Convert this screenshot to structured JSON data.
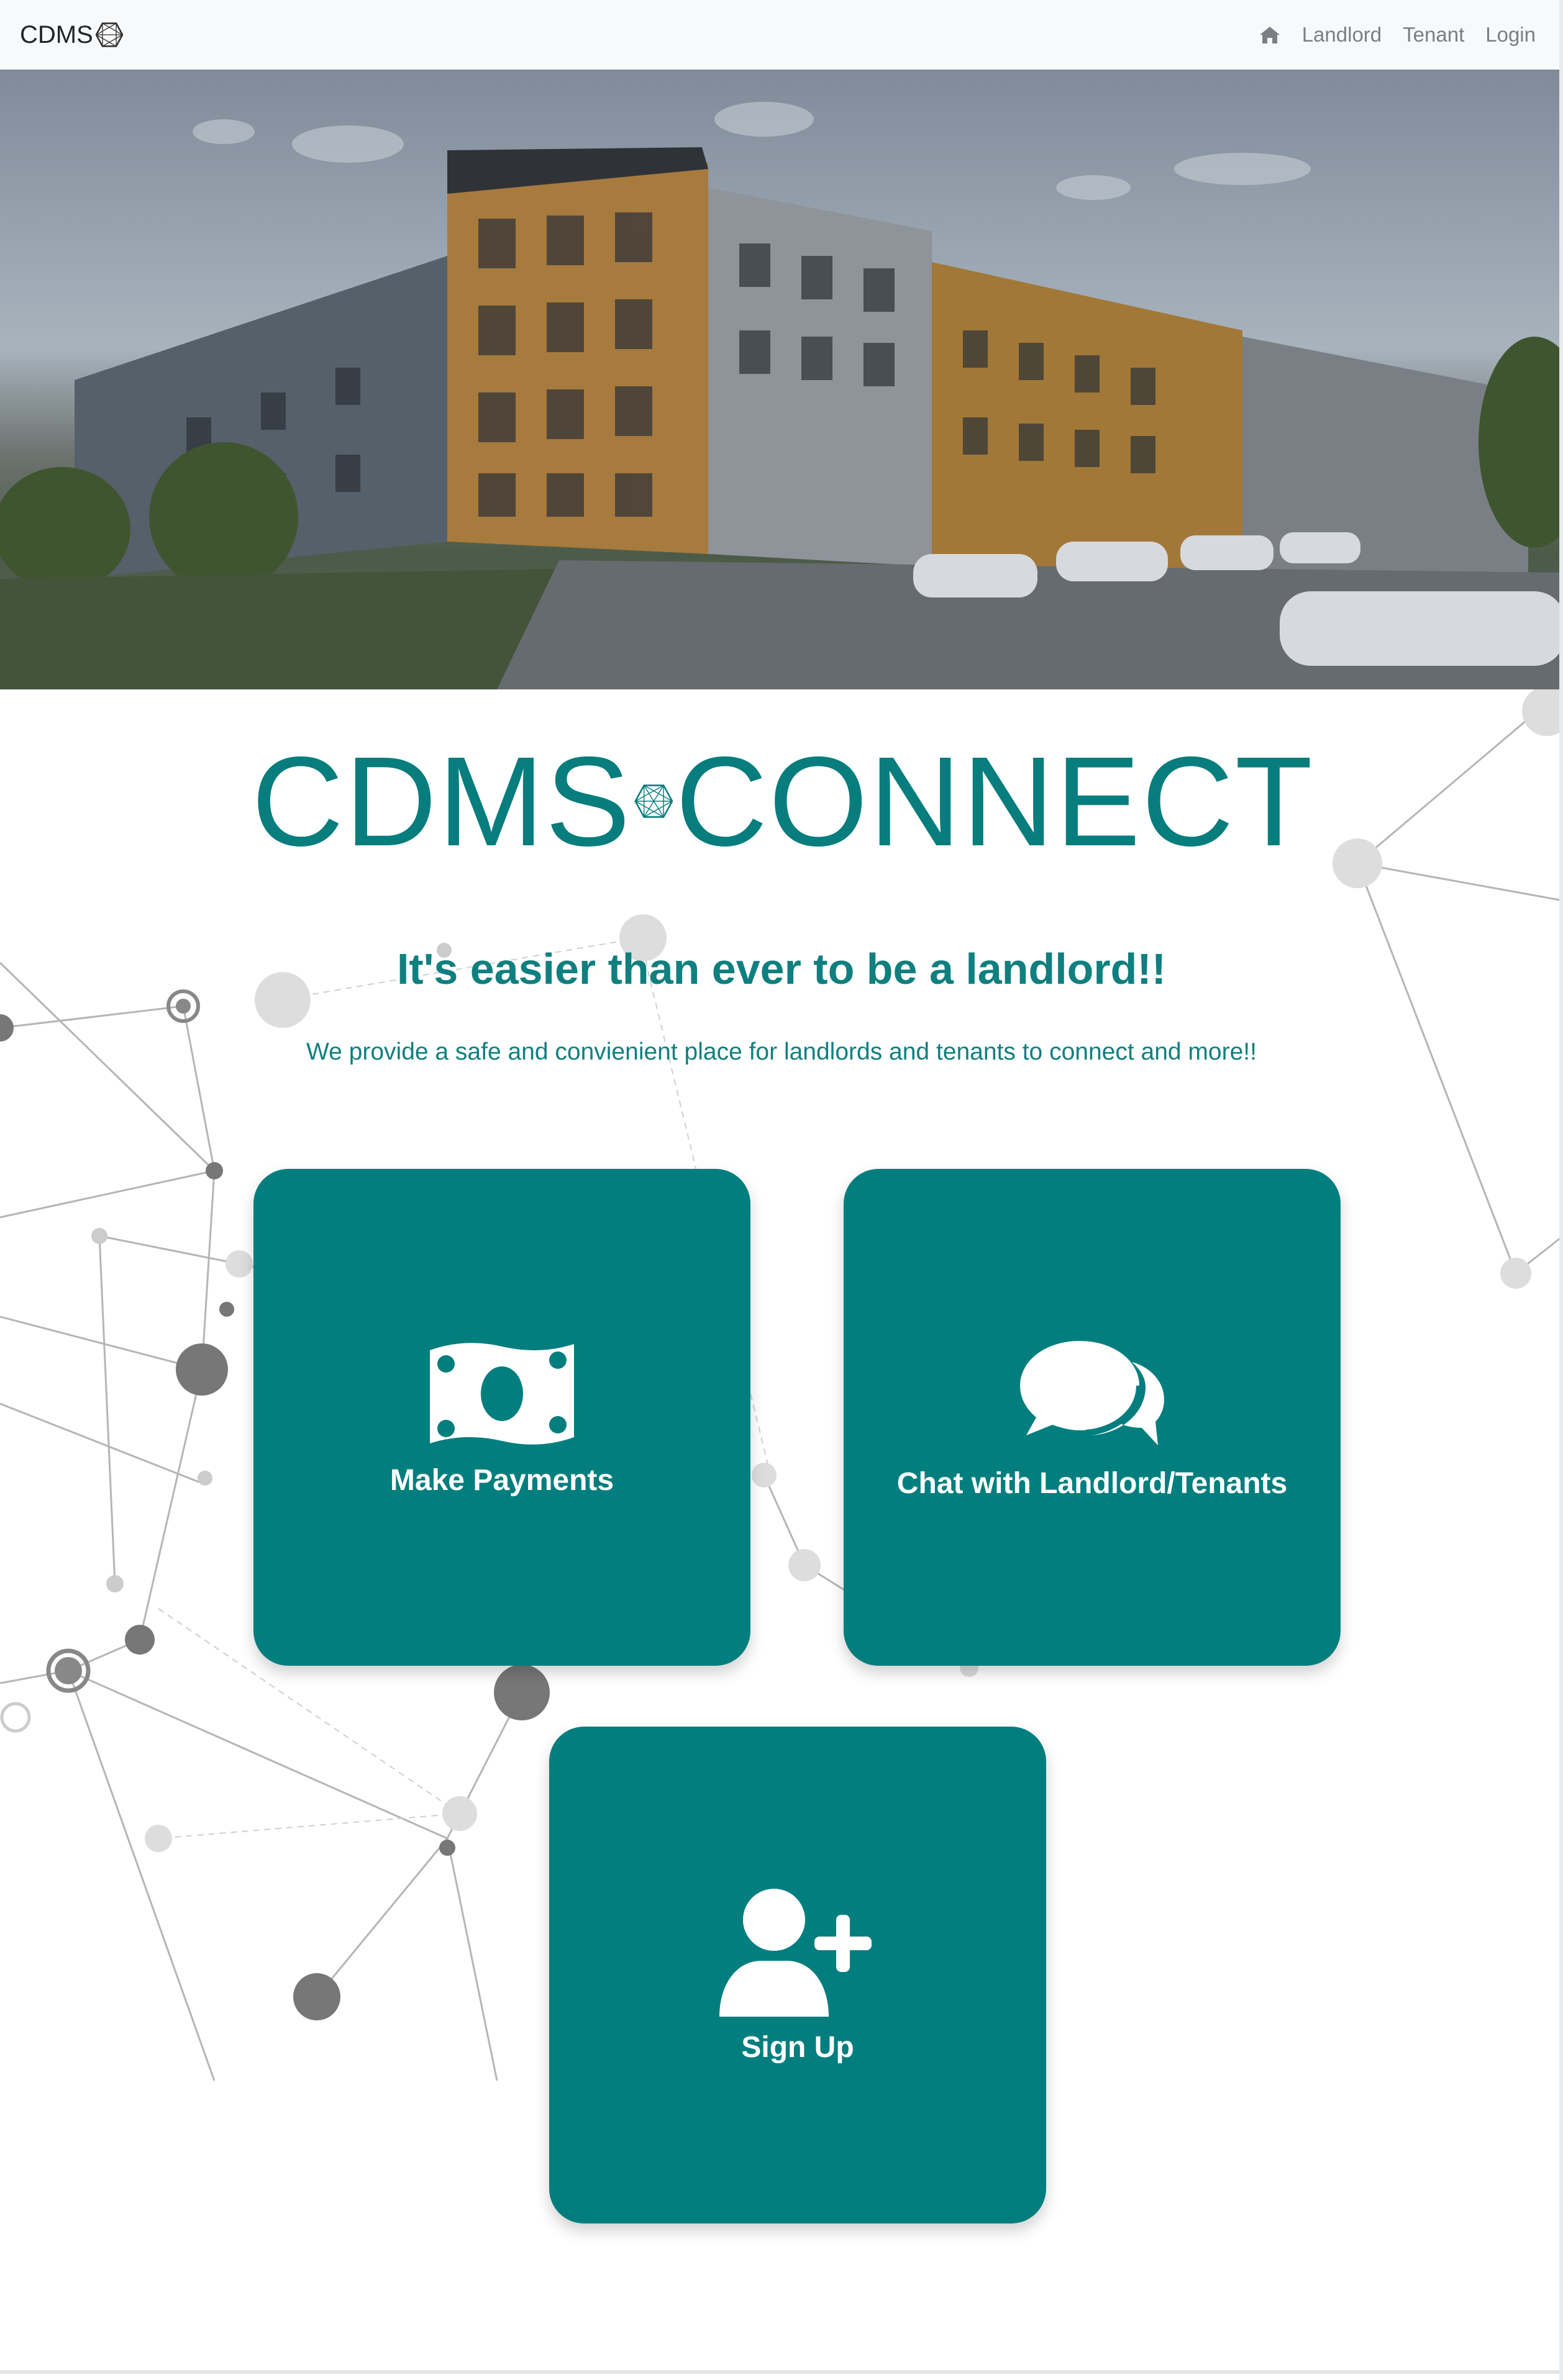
{
  "navbar": {
    "brand": "CDMS",
    "brand_icon": "hexagon-logo-icon",
    "home_icon": "home-icon",
    "links": [
      {
        "label": "Landlord"
      },
      {
        "label": "Tenant"
      },
      {
        "label": "Login"
      }
    ]
  },
  "hero": {
    "image_alt": "apartment-building-photo"
  },
  "logo": {
    "left": "CDMS",
    "right": "CONNECT",
    "icon": "hexagon-network-icon"
  },
  "tagline": "It's easier than ever to be a landlord!!",
  "subtext": "We provide a safe and convienient place for landlords and tenants to connect and more!!",
  "cards": [
    {
      "label": "Make Payments",
      "icon": "money-bill-icon"
    },
    {
      "label": "Chat with Landlord/Tenants",
      "icon": "comments-icon"
    },
    {
      "label": "Sign Up",
      "icon": "user-plus-icon"
    }
  ],
  "colors": {
    "brand_teal": "#027e7e",
    "navbar_bg": "#f8f9fa",
    "nav_link": "#7a7f85"
  }
}
